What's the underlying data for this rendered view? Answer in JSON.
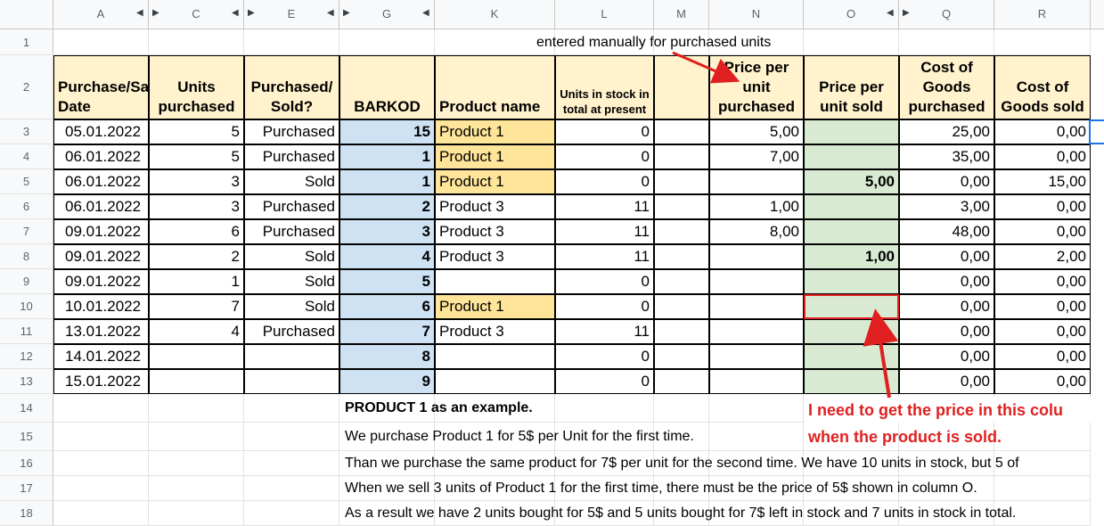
{
  "columns": [
    "A",
    "C",
    "E",
    "G",
    "K",
    "L",
    "M",
    "N",
    "O",
    "Q",
    "R"
  ],
  "rows": [
    "1",
    "2",
    "3",
    "4",
    "5",
    "6",
    "7",
    "8",
    "9",
    "10",
    "11",
    "12",
    "13",
    "14",
    "15",
    "16",
    "17",
    "18"
  ],
  "note_top": "entered manually for purchased units",
  "headers": {
    "date": "Purchase/Sale Date",
    "units": "Units purchased",
    "ps": "Purchased/ Sold?",
    "barkod": "BARKOD",
    "product": "Product name",
    "stock": "Units in stock in total at present",
    "m": "",
    "ppu": "Price per unit purchased",
    "pus": "Price per unit sold",
    "cgp": "Cost of Goods purchased",
    "cgs": "Cost of Goods sold"
  },
  "data_rows": [
    {
      "date": "05.01.2022",
      "units": "5",
      "ps": "Purchased",
      "barkod": "15",
      "product": "Product 1",
      "stock": "0",
      "ppu": "5,00",
      "pus": "",
      "cgp": "25,00",
      "cgs": "0,00"
    },
    {
      "date": "06.01.2022",
      "units": "5",
      "ps": "Purchased",
      "barkod": "1",
      "product": "Product 1",
      "stock": "0",
      "ppu": "7,00",
      "pus": "",
      "cgp": "35,00",
      "cgs": "0,00"
    },
    {
      "date": "06.01.2022",
      "units": "3",
      "ps": "Sold",
      "barkod": "1",
      "product": "Product 1",
      "stock": "0",
      "ppu": "",
      "pus": "5,00",
      "cgp": "0,00",
      "cgs": "15,00"
    },
    {
      "date": "06.01.2022",
      "units": "3",
      "ps": "Purchased",
      "barkod": "2",
      "product": "Product 3",
      "stock": "11",
      "ppu": "1,00",
      "pus": "",
      "cgp": "3,00",
      "cgs": "0,00"
    },
    {
      "date": "09.01.2022",
      "units": "6",
      "ps": "Purchased",
      "barkod": "3",
      "product": "Product 3",
      "stock": "11",
      "ppu": "8,00",
      "pus": "",
      "cgp": "48,00",
      "cgs": "0,00"
    },
    {
      "date": "09.01.2022",
      "units": "2",
      "ps": "Sold",
      "barkod": "4",
      "product": "Product 3",
      "stock": "11",
      "ppu": "",
      "pus": "1,00",
      "cgp": "0,00",
      "cgs": "2,00"
    },
    {
      "date": "09.01.2022",
      "units": "1",
      "ps": "Sold",
      "barkod": "5",
      "product": "",
      "stock": "0",
      "ppu": "",
      "pus": "",
      "cgp": "0,00",
      "cgs": "0,00"
    },
    {
      "date": "10.01.2022",
      "units": "7",
      "ps": "Sold",
      "barkod": "6",
      "product": "Product 1",
      "stock": "0",
      "ppu": "",
      "pus": "",
      "cgp": "0,00",
      "cgs": "0,00"
    },
    {
      "date": "13.01.2022",
      "units": "4",
      "ps": "Purchased",
      "barkod": "7",
      "product": "Product 3",
      "stock": "11",
      "ppu": "",
      "pus": "",
      "cgp": "0,00",
      "cgs": "0,00"
    },
    {
      "date": "14.01.2022",
      "units": "",
      "ps": "",
      "barkod": "8",
      "product": "",
      "stock": "0",
      "ppu": "",
      "pus": "",
      "cgp": "0,00",
      "cgs": "0,00"
    },
    {
      "date": "15.01.2022",
      "units": "",
      "ps": "",
      "barkod": "9",
      "product": "",
      "stock": "0",
      "ppu": "",
      "pus": "",
      "cgp": "0,00",
      "cgs": "0,00"
    }
  ],
  "example_title": "PRODUCT 1 as an example.",
  "example_lines": [
    "We purchase Product 1 for 5$ per Unit for the first time.",
    "Than we purchase the same product for 7$ per unit for the second time. We have 10 units in stock, but 5 of",
    "When we sell 3 units of Product 1 for the first time, there must be the price of 5$ shown in column O.",
    "As a result we have 2 units bought for 5$ and 5 units bought for 7$ left in stock and 7 units in stock in total."
  ],
  "callout": [
    "I need to get the price in this colu",
    "when the product is sold."
  ],
  "colors": {
    "yellow": "#fff2cc",
    "blue": "#cfe2f3",
    "green": "#d9ead3",
    "orange": "#ffe599",
    "red": "#e02020"
  }
}
